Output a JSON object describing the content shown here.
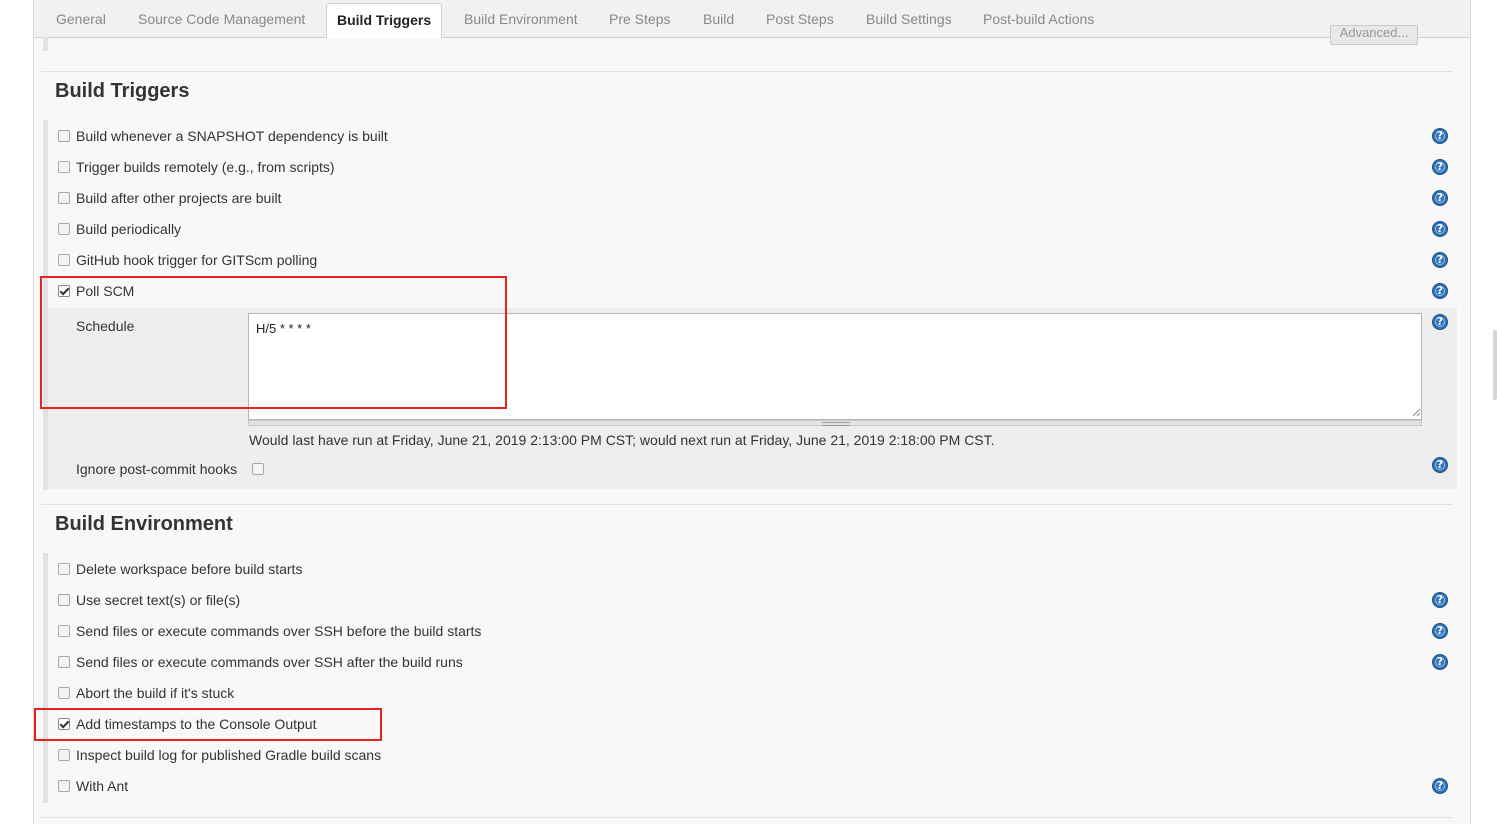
{
  "tabs": [
    {
      "label": "General"
    },
    {
      "label": "Source Code Management"
    },
    {
      "label": "Build Triggers"
    },
    {
      "label": "Build Environment"
    },
    {
      "label": "Pre Steps"
    },
    {
      "label": "Build"
    },
    {
      "label": "Post Steps"
    },
    {
      "label": "Build Settings"
    },
    {
      "label": "Post-build Actions"
    }
  ],
  "active_tab": "Build Triggers",
  "advanced_button": "Advanced...",
  "build_triggers": {
    "title": "Build Triggers",
    "options": [
      {
        "label": "Build whenever a SNAPSHOT dependency is built",
        "checked": false,
        "help": true
      },
      {
        "label": "Trigger builds remotely (e.g., from scripts)",
        "checked": false,
        "help": true
      },
      {
        "label": "Build after other projects are built",
        "checked": false,
        "help": true
      },
      {
        "label": "Build periodically",
        "checked": false,
        "help": true
      },
      {
        "label": "GitHub hook trigger for GITScm polling",
        "checked": false,
        "help": true
      },
      {
        "label": "Poll SCM",
        "checked": true,
        "help": true
      }
    ],
    "schedule": {
      "label": "Schedule",
      "value": "H/5 * * * *",
      "info": "Would last have run at Friday, June 21, 2019 2:13:00 PM CST; would next run at Friday, June 21, 2019 2:18:00 PM CST."
    },
    "ignore_post_commit": {
      "label": "Ignore post-commit hooks",
      "checked": false
    }
  },
  "build_environment": {
    "title": "Build Environment",
    "options": [
      {
        "label": "Delete workspace before build starts",
        "checked": false,
        "help": false
      },
      {
        "label": "Use secret text(s) or file(s)",
        "checked": false,
        "help": true
      },
      {
        "label": "Send files or execute commands over SSH before the build starts",
        "checked": false,
        "help": true
      },
      {
        "label": "Send files or execute commands over SSH after the build runs",
        "checked": false,
        "help": true
      },
      {
        "label": "Abort the build if it's stuck",
        "checked": false,
        "help": false
      },
      {
        "label": "Add timestamps to the Console Output",
        "checked": true,
        "help": false
      },
      {
        "label": "Inspect build log for published Gradle build scans",
        "checked": false,
        "help": false
      },
      {
        "label": "With Ant",
        "checked": false,
        "help": true
      }
    ]
  },
  "help_icon_glyph": "?",
  "colors": {
    "highlight_box": "#e8231f",
    "help_icon": "#2f72b8",
    "subpanel_bg": "#eeeeee"
  }
}
